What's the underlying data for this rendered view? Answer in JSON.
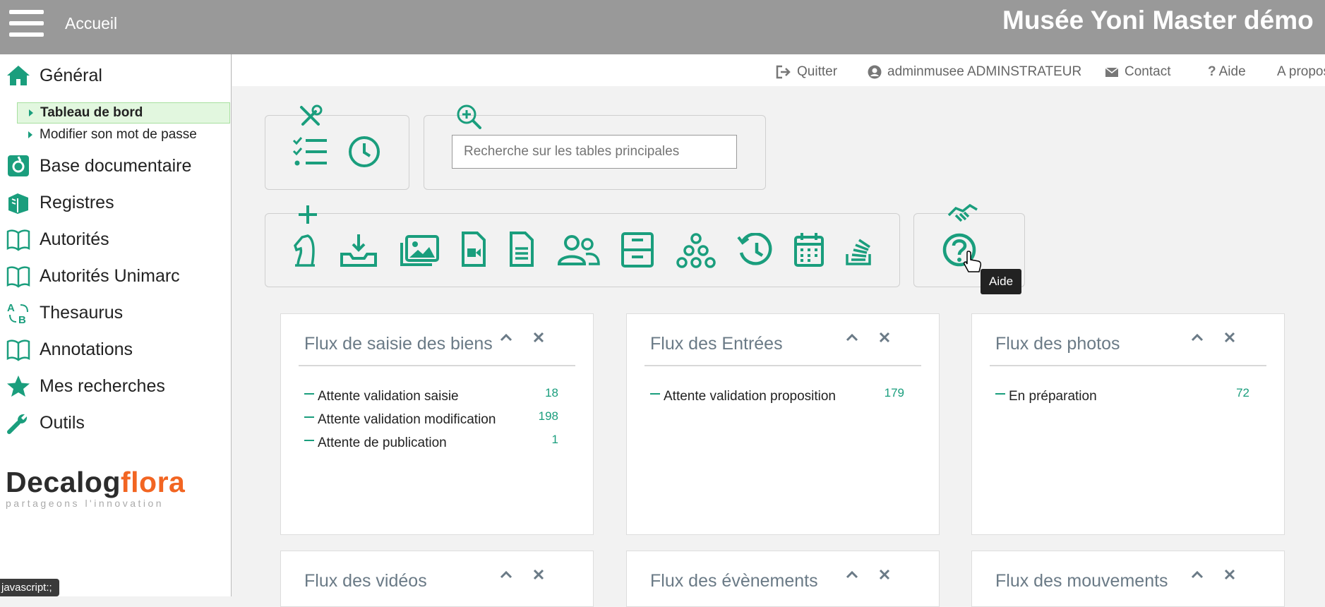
{
  "header": {
    "menu_icon": "hamburger-icon",
    "home_label": "Accueil",
    "app_title": "Musée Yoni Master démo"
  },
  "colors": {
    "accent": "#1a9e7d",
    "header_bg": "#999999",
    "active_bg": "#e2f7df",
    "logo_orange": "#f26522"
  },
  "sidebar": {
    "items": [
      {
        "label": "Général",
        "icon": "home-icon"
      },
      {
        "label": "Base documentaire",
        "icon": "documents-icon"
      },
      {
        "label": "Registres",
        "icon": "books-icon"
      },
      {
        "label": "Autorités",
        "icon": "book-icon"
      },
      {
        "label": "Autorités Unimarc",
        "icon": "book-icon"
      },
      {
        "label": "Thesaurus",
        "icon": "thesaurus-icon"
      },
      {
        "label": "Annotations",
        "icon": "book-icon"
      },
      {
        "label": "Mes recherches",
        "icon": "star-icon"
      },
      {
        "label": "Outils",
        "icon": "wrench-icon"
      }
    ],
    "sub_items": [
      {
        "label": "Tableau de bord",
        "active": true
      },
      {
        "label": "Modifier son mot de passe",
        "active": false
      }
    ],
    "logo_part1": "Decalog",
    "logo_part2": "flora",
    "logo_tagline": "partageons l'innovation",
    "status_text": "javascript:;"
  },
  "userbar": {
    "quit": "Quitter",
    "user": "adminmusee ADMINSTRATEUR",
    "contact": "Contact",
    "help": "Aide",
    "about": "A propos"
  },
  "toolbar": {
    "search_placeholder": "Recherche sur les tables principales",
    "tooltip": "Aide",
    "icons": [
      "tools-icon",
      "checklist-icon",
      "clock-icon",
      "zoom-in-icon",
      "plus-icon",
      "chess-knight-icon",
      "inbox-download-icon",
      "images-icon",
      "video-file-icon",
      "text-file-icon",
      "users-icon",
      "archive-icon",
      "hierarchy-icon",
      "history-icon",
      "calendar-icon",
      "stack-icon",
      "handshake-icon",
      "help-icon"
    ]
  },
  "cards": [
    {
      "title": "Flux de saisie des biens",
      "rows": [
        {
          "label": "Attente validation saisie",
          "value": "18"
        },
        {
          "label": "Attente validation modification",
          "value": "198"
        },
        {
          "label": "Attente de publication",
          "value": "1"
        }
      ]
    },
    {
      "title": "Flux des Entrées",
      "rows": [
        {
          "label": "Attente validation proposition",
          "value": "179"
        }
      ]
    },
    {
      "title": "Flux des photos",
      "rows": [
        {
          "label": "En préparation",
          "value": "72"
        }
      ]
    },
    {
      "title": "Flux des vidéos",
      "rows": []
    },
    {
      "title": "Flux des évènements",
      "rows": []
    },
    {
      "title": "Flux des mouvements",
      "rows": []
    }
  ]
}
